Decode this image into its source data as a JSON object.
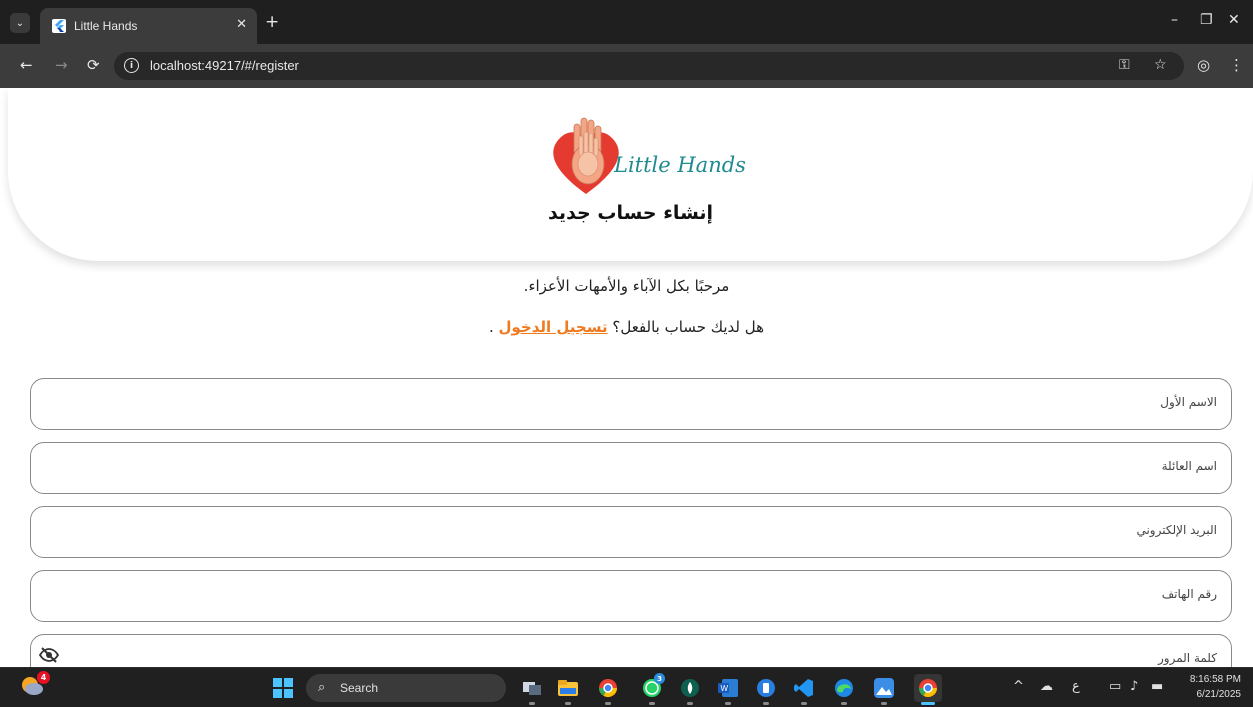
{
  "browser": {
    "tab_title": "Little Hands",
    "tab_close": "✕",
    "new_tab": "+",
    "url": "localhost:49217/#/register",
    "window_controls": {
      "minimize": "–",
      "restore": "❐",
      "close": "✕"
    }
  },
  "page": {
    "logo_text": "Little Hands",
    "title": "إنشاء حساب جديد",
    "welcome": "مرحبًا بكل الآباء والأمهات الأعزاء.",
    "login_prompt": "هل لديك حساب بالفعل؟",
    "login_link": "تسجيل الدخول",
    "login_suffix": " ."
  },
  "form": {
    "fields": [
      {
        "label": "الاسم الأول"
      },
      {
        "label": "اسم العائلة"
      },
      {
        "label": "البريد الإلكتروني"
      },
      {
        "label": "رقم الهاتف"
      },
      {
        "label": "كلمة المرور"
      }
    ]
  },
  "taskbar": {
    "widget_badge": "4",
    "search_label": "Search",
    "whatsapp_badge": "3",
    "tray_lang": "ع",
    "clock_time": "8:16:58 PM",
    "clock_date": "6/21/2025"
  },
  "colors": {
    "accent": "#f07a1f",
    "logo_text": "#1f8a8f",
    "heart": "#e53a2f"
  },
  "icons": [
    "tab-dropdown-icon",
    "flutter-favicon",
    "back-arrow-icon",
    "forward-arrow-icon",
    "reload-icon",
    "site-info-icon",
    "password-key-icon",
    "bookmark-star-icon",
    "profile-icon",
    "menu-kebab-icon",
    "eye-off-icon",
    "windows-start-icon",
    "search-icon"
  ]
}
